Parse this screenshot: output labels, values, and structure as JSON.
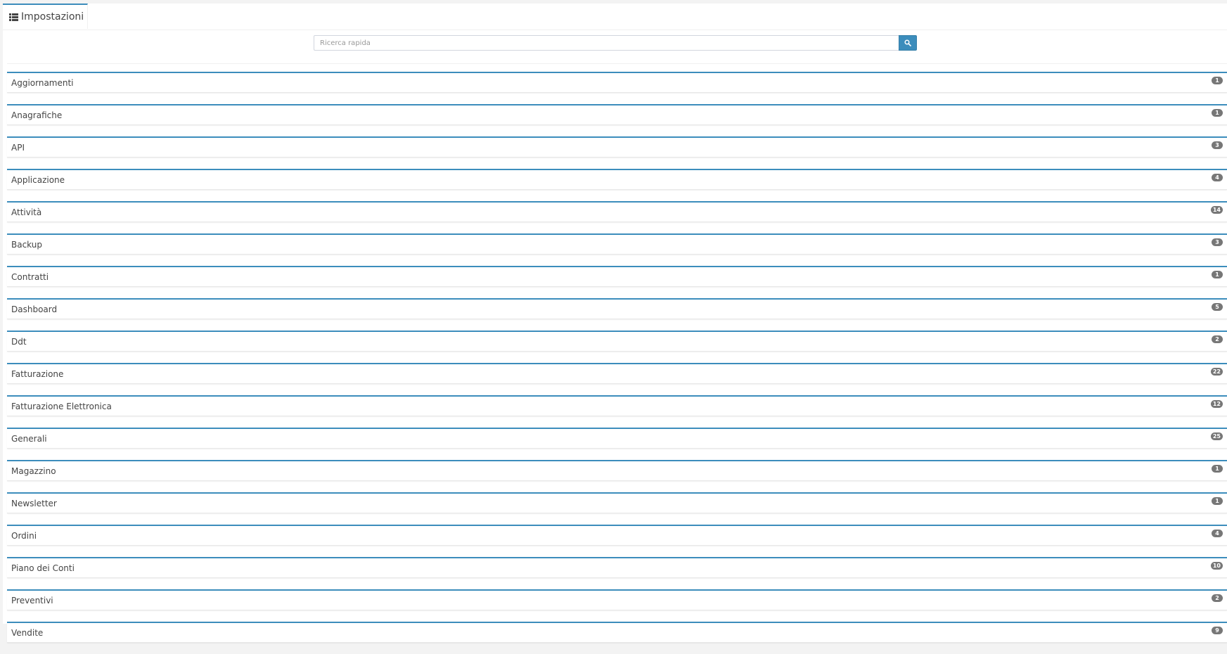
{
  "tab": {
    "label": "Impostazioni",
    "icon": "list-icon"
  },
  "search": {
    "placeholder": "Ricerca rapida",
    "value": "",
    "button_icon": "search-icon"
  },
  "colors": {
    "accent": "#3c8dbc",
    "badge": "#777777"
  },
  "sections": [
    {
      "title": "Aggiornamenti",
      "count": "1"
    },
    {
      "title": "Anagrafiche",
      "count": "1"
    },
    {
      "title": "API",
      "count": "3"
    },
    {
      "title": "Applicazione",
      "count": "4"
    },
    {
      "title": "Attività",
      "count": "14"
    },
    {
      "title": "Backup",
      "count": "3"
    },
    {
      "title": "Contratti",
      "count": "1"
    },
    {
      "title": "Dashboard",
      "count": "5"
    },
    {
      "title": "Ddt",
      "count": "2"
    },
    {
      "title": "Fatturazione",
      "count": "22"
    },
    {
      "title": "Fatturazione Elettronica",
      "count": "12"
    },
    {
      "title": "Generali",
      "count": "25"
    },
    {
      "title": "Magazzino",
      "count": "1"
    },
    {
      "title": "Newsletter",
      "count": "1"
    },
    {
      "title": "Ordini",
      "count": "4"
    },
    {
      "title": "Piano dei Conti",
      "count": "10"
    },
    {
      "title": "Preventivi",
      "count": "2"
    },
    {
      "title": "Vendite",
      "count": "9"
    }
  ]
}
